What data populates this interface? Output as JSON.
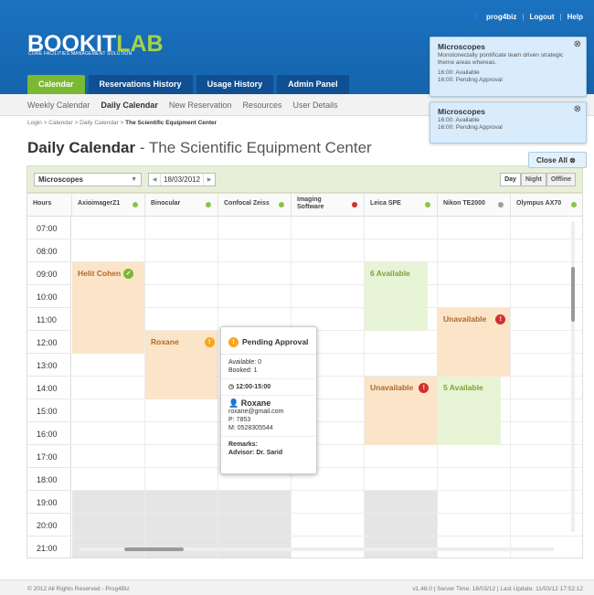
{
  "topbar": {
    "user": "prog4biz",
    "logout": "Logout",
    "help": "Help"
  },
  "logo": {
    "main": "BOOKIT",
    "accent": "LAB",
    "tagline": "CORE FACILITIES MANAGEMENT SOLUTION"
  },
  "tabs": [
    "Calendar",
    "Reservations History",
    "Usage History",
    "Admin Panel"
  ],
  "subnav": [
    "Weekly Calendar",
    "Daily Calendar",
    "New Reservation",
    "Resources",
    "User Details"
  ],
  "breadcrumb": {
    "path": "Login > Calendar > Daily Calendar > ",
    "current": "The Scientific Equipment Center"
  },
  "page_title": {
    "main": "Daily Calendar",
    "sub": " - The Scientific Equipment Center"
  },
  "toolbar": {
    "facility": "Microscopes",
    "date": "18/03/2012",
    "views": [
      "Day",
      "Night",
      "Offline"
    ]
  },
  "columns": [
    {
      "name": "Hours"
    },
    {
      "name": "AxioimagerZ1",
      "status": "#8bc34a"
    },
    {
      "name": "Binocular",
      "status": "#8bc34a"
    },
    {
      "name": "Confocal Zeiss",
      "status": "#8bc34a"
    },
    {
      "name": "Imaging Software",
      "status": "#d32f2f"
    },
    {
      "name": "Leica SPE",
      "status": "#8bc34a"
    },
    {
      "name": "Nikon TE2000",
      "status": "#9e9e9e"
    },
    {
      "name": "Olympus AX70",
      "status": "#8bc34a"
    }
  ],
  "hours": [
    "07:00",
    "08:00",
    "09:00",
    "10:00",
    "11:00",
    "12:00",
    "13:00",
    "14:00",
    "15:00",
    "16:00",
    "17:00",
    "18:00",
    "19:00",
    "20:00",
    "21:00"
  ],
  "blocks": {
    "helit": "Helit Cohen",
    "roxane": "Roxane",
    "six_available": "6 Available",
    "unavail_nikon": "Unavailable",
    "unavail_leica": "Unavailable",
    "five_available": "5 Available"
  },
  "popup": {
    "title": "Pending Approval",
    "available": "Available: 0",
    "booked": "Booked: 1",
    "time": "12:00-15:00",
    "name": "Roxane",
    "email": "roxane@gmail.com",
    "phone": "P: 7853",
    "mobile": "M: 0528305544",
    "remarks": "Remarks:",
    "advisor": "Advisor: Dr. Sarid"
  },
  "notifications": [
    {
      "title": "Microscopes",
      "text": "Monotonectally pontificate team driven strategic theme areas whereas.",
      "l1": "16:00: Available",
      "l2": "16:00: Pending Approval"
    },
    {
      "title": "Microscopes",
      "l1": "16:00: Available",
      "l2": "16:00: Pending Approval"
    }
  ],
  "close_all": "Close All",
  "footer": {
    "left": "© 2012 All Rights Reserved - Prog4Biz",
    "right": "v1.48.0 | Server Time: 18/03/12 | Last Update: 11/03/12 17:52:12"
  }
}
